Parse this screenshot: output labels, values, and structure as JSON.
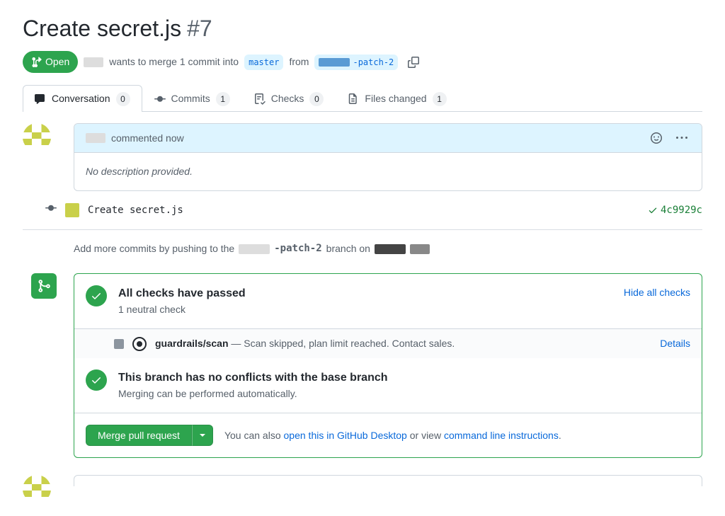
{
  "header": {
    "title": "Create secret.js",
    "number": "#7",
    "state": "Open",
    "meta_wants": "wants to merge 1 commit into",
    "base_branch": "master",
    "meta_from": "from",
    "head_branch_suffix": "-patch-2"
  },
  "tabs": {
    "conversation": {
      "label": "Conversation",
      "count": "0"
    },
    "commits": {
      "label": "Commits",
      "count": "1"
    },
    "checks": {
      "label": "Checks",
      "count": "0"
    },
    "files": {
      "label": "Files changed",
      "count": "1"
    }
  },
  "comment": {
    "meta": "commented now",
    "body": "No description provided."
  },
  "commit": {
    "message": "Create secret.js",
    "sha": "4c9929c"
  },
  "push_hint": {
    "prefix": "Add more commits by pushing to the",
    "branch_suffix": "-patch-2",
    "mid": "branch on"
  },
  "merge": {
    "checks_title": "All checks have passed",
    "checks_sub": "1 neutral check",
    "hide_link": "Hide all checks",
    "check_item": {
      "name": "guardrails/scan",
      "desc": " — Scan skipped, plan limit reached. Contact sales.",
      "details": "Details"
    },
    "conflict_title": "This branch has no conflicts with the base branch",
    "conflict_sub": "Merging can be performed automatically.",
    "button": "Merge pull request",
    "hint_prefix": "You can also ",
    "hint_link1": "open this in GitHub Desktop",
    "hint_mid": " or view ",
    "hint_link2": "command line instructions",
    "hint_suffix": "."
  }
}
